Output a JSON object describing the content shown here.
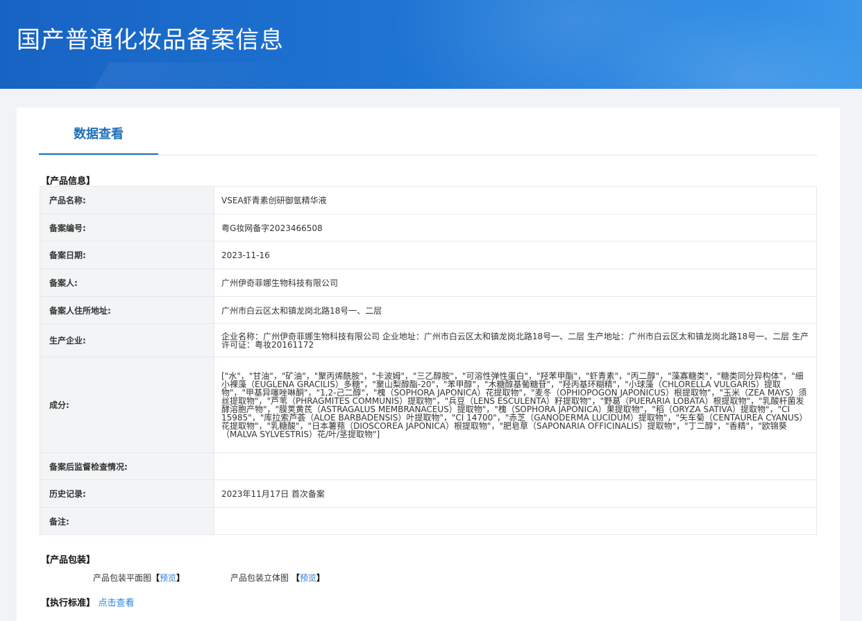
{
  "header": {
    "title": "国产普通化妆品备案信息"
  },
  "tabs": [
    {
      "label": "数据查看"
    }
  ],
  "product_info": {
    "section_title": "【产品信息】",
    "rows": [
      {
        "key": "产品名称:",
        "value": "VSEA虾青素创研御氩精华液"
      },
      {
        "key": "备案编号:",
        "value": "粤G妆网备字2023466508"
      },
      {
        "key": "备案日期:",
        "value": "2023-11-16"
      },
      {
        "key": "备案人:",
        "value": "广州伊奇菲娜生物科技有限公司"
      },
      {
        "key": "备案人住所地址:",
        "value": "广州市白云区太和镇龙岗北路18号一、二层"
      },
      {
        "key": "生产企业:",
        "value": "企业名称：广州伊奇菲娜生物科技有限公司 企业地址：广州市白云区太和镇龙岗北路18号一、二层 生产地址：广州市白云区太和镇龙岗北路18号一、二层 生产许可证：粤妆20161172"
      },
      {
        "key": "成分:",
        "value": "[\"水\"，\"甘油\"，\"矿油\"，\"聚丙烯酰胺\"，\"卡波姆\"，\"三乙醇胺\"，\"可溶性弹性蛋白\"，\"羟苯甲酯\"，\"虾青素\"，\"丙二醇\"，\"藻寡糖类\"，\"糖类同分异构体\"，\"细小裸藻（EUGLENA GRACILIS）多糖\"，\"聚山梨醇酯-20\"，\"苯甲醇\"，\"木糖醇基葡糖苷\"，\"羟丙基环糊精\"，\"小球藻（CHLORELLA VULGARIS）提取物\"，\"甲基异噻唑啉酮\"，\"1,2-己二醇\"，\"槐（SOPHORA JAPONICA）花提取物\"，\"麦冬（OPHIOPOGON JAPONICUS）根提取物\"，\"玉米（ZEA MAYS）须丝提取物\"，\"芦苇（PHRAGMITES COMMUNIS）提取物\"，\"兵豆（LENS ESCULENTA）籽提取物\"，\"野葛（PUERARIA LOBATA）根提取物\"，\"乳酸杆菌发酵溶胞产物\"，\"膜荚黄芪（ASTRAGALUS MEMBRANACEUS）提取物\"，\"槐（SOPHORA JAPONICA）果提取物\"，\"稻（ORYZA SATIVA）提取物\"，\"CI 15985\"，\"库拉索芦荟（ALOE BARBADENSIS）叶提取物\"，\"CI 14700\"，\"赤芝（GANODERMA LUCIDUM）提取物\"，\"矢车菊（CENTAUREA CYANUS）花提取物\"，\"乳糖酸\"，\"日本薯蓣（DIOSCOREA JAPONICA）根提取物\"，\"肥皂草（SAPONARIA OFFICINALIS）提取物\"，\"丁二醇\"，\"香精\"，\"欧锦葵（MALVA SYLVESTRIS）花/叶/茎提取物\"]"
      },
      {
        "key": "备案后监督检查情况:",
        "value": ""
      },
      {
        "key": "历史记录:",
        "value": "2023年11月17日 首次备案"
      },
      {
        "key": "备注:",
        "value": ""
      }
    ]
  },
  "packaging": {
    "section_title": "【产品包装】",
    "flat_label": "产品包装平面图",
    "flat_link": "预览",
    "stereo_label": "产品包装立体图",
    "stereo_link": "预览"
  },
  "standard": {
    "section_title": "【执行标准】",
    "link": "点击查看"
  }
}
